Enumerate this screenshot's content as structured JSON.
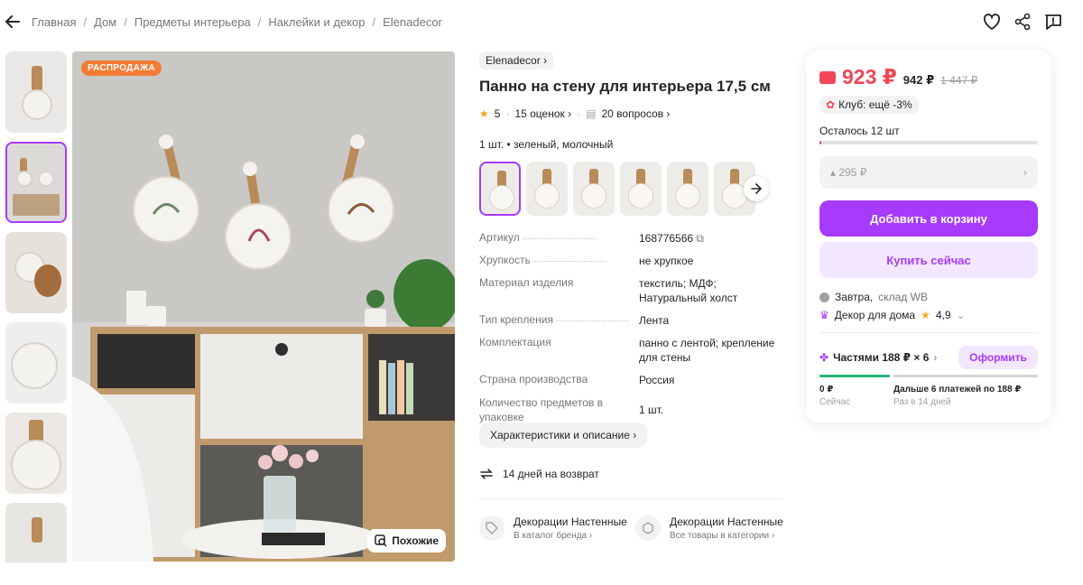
{
  "breadcrumbs": [
    "Главная",
    "Дом",
    "Предметы интерьера",
    "Наклейки и декор",
    "Elenadecor"
  ],
  "gallery": {
    "sale_badge": "РАСПРОДАЖА",
    "similar_label": "Похожие"
  },
  "product": {
    "brand": "Elenadecor",
    "title": "Панно на стену для интерьера 17,5 см",
    "rating": "5",
    "reviews": "15 оценок",
    "questions": "20 вопросов",
    "variant": "1 шт. • зеленый, молочный"
  },
  "specs": [
    {
      "key": "Артикул",
      "value": "168776566"
    },
    {
      "key": "Хрупкость",
      "value": "не хрупкое"
    },
    {
      "key": "Материал изделия",
      "value": "текстиль; МДФ; Натуральный холст"
    },
    {
      "key": "Тип крепления",
      "value": "Лента"
    },
    {
      "key": "Комплектация",
      "value": "панно с лентой; крепление для стены"
    },
    {
      "key": "Страна производства",
      "value": "Россия"
    },
    {
      "key": "Количество предметов в упаковке",
      "value": "1 шт."
    }
  ],
  "chars_button": "Характеристики и описание",
  "return_text": "14 дней на возврат",
  "links": [
    {
      "title": "Декорации Настенные",
      "sub": "В каталог бренда"
    },
    {
      "title": "Декорации Настенные",
      "sub": "Все товары в категории"
    }
  ],
  "buy": {
    "price_now": "923 ₽",
    "price_mid": "942 ₽",
    "price_old": "1 447 ₽",
    "club": "Клуб: ещё -3%",
    "stock": "Осталось 12 шт",
    "stock_fraction": 0.01,
    "wb_price": "295 ₽",
    "add_to_cart": "Добавить в корзину",
    "buy_now": "Купить сейчас",
    "delivery_day": "Завтра,",
    "delivery_place": "склад WB",
    "seller": "Декор для дома",
    "seller_rating": "4,9",
    "installment": "Частями 188 ₽ × 6",
    "arrange": "Оформить",
    "now_amount": "0 ₽",
    "now_label": "Сейчас",
    "later_amount": "Дальше 6 платежей по 188 ₽",
    "later_label": "Раз в 14 дней"
  },
  "colors": {
    "accent": "#a73afd",
    "price": "#f04757",
    "sale": "#f37b35",
    "success": "#22b573"
  }
}
